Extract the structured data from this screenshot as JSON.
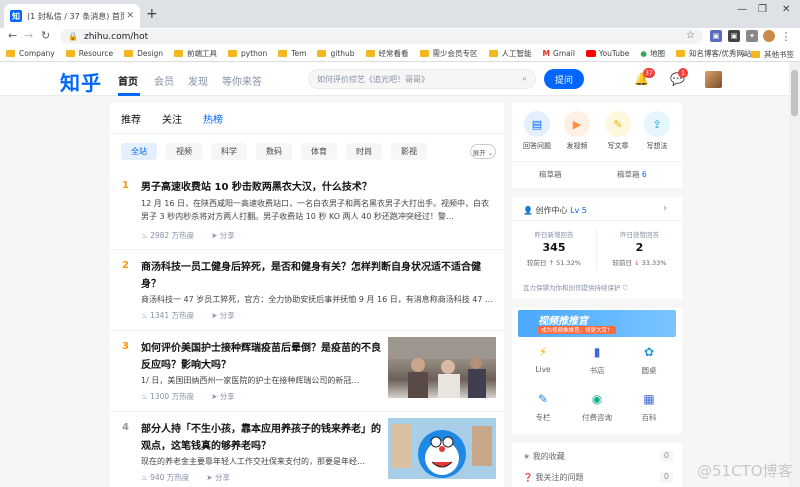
{
  "browser": {
    "tab_title": "(1 封私信 / 37 条消息) 首页 - 知",
    "tab_icon": "知",
    "url": "zhihu.com/hot",
    "bookmarks": [
      "Company",
      "Resource",
      "Design",
      "前端工具",
      "python",
      "Tem",
      "github",
      "经常看看",
      "需少会员专区",
      "人工智能",
      "Gmail",
      "YouTube",
      "地图",
      "知名博客/优秀网站"
    ],
    "bookmarks_right": "其他书签"
  },
  "header": {
    "logo": "知乎",
    "nav": [
      "首页",
      "会员",
      "发现",
      "等你来答"
    ],
    "search_placeholder": "如何评价综艺《追光吧！哥哥》",
    "ask_button": "提问",
    "notification_count": "37",
    "message_count": "1"
  },
  "feed": {
    "tabs": [
      "推荐",
      "关注",
      "热榜"
    ],
    "chips": [
      "全站",
      "视频",
      "科学",
      "数码",
      "体育",
      "时尚",
      "影视"
    ],
    "expand": "展开 ⌄",
    "items": [
      {
        "rank": "1",
        "title": "男子高速收费站 10 秒击败两黑衣大汉，什么技术？",
        "excerpt": "12 月 16 日，在陕西咸阳一高速收费站口，一名白衣男子和两名黑衣男子大打出手。视频中，白衣男子 3 秒内秒杀将对方两人打翻。男子收费站 10 秒 KO 两人 40 秒还跑冲突经过！警…",
        "heat": "2982 万热度",
        "share": "分享",
        "rank_color": "#ff9607"
      },
      {
        "rank": "2",
        "title": "商汤科技一员工健身后猝死，是否和健身有关？怎样判断自身状况适不适合健身？",
        "excerpt": "商汤科技一 47 岁员工猝死，官方：全力协助安抚后事并抚恤 9 月 16 日，有消息称商汤科技 47 …",
        "heat": "1341 万热度",
        "share": "分享",
        "rank_color": "#ff9607"
      },
      {
        "rank": "3",
        "title": "如何评价美国护士接种辉瑞疫苗后晕倒？是疫苗的不良反应吗？影响大吗？",
        "excerpt": "1/ 日，美国田纳西州一家医院的护士在接种辉瑞公司的新冠…",
        "heat": "1300 万热度",
        "share": "分享",
        "rank_color": "#ff9607"
      },
      {
        "rank": "4",
        "title": "部分人持「不生小孩，靠本应用养孩子的钱来养老」的观点，这笔钱真的够养老吗？",
        "excerpt": "现在的养老金主要靠年轻人工作交社保来支付的，那要是年经…",
        "heat": "940 万热度",
        "share": "分享",
        "rank_color": "#999999"
      }
    ]
  },
  "sidebar": {
    "creation_icons": [
      "回答问题",
      "发视频",
      "写文章",
      "写想法"
    ],
    "drafts_label": "稿草箱",
    "drafts_short": "稿草箱",
    "draft_count": "6",
    "creator_center": "创作中心",
    "creator_level": "Lv 5",
    "stat1_label": "昨日新增回答",
    "stat1_value": "345",
    "stat1_prefix": "较前日",
    "stat1_change": "51.32%",
    "stat2_label": "昨日获赞回答",
    "stat2_value": "2",
    "stat2_prefix": "较前日",
    "stat2_change": "33.33%",
    "creator_tip": "瓦力保镖为你和创作提供持续保护",
    "banner_title": "视频推推官",
    "banner_sub": "成为视频推推官，领更大赏！",
    "grid": [
      "Live",
      "书店",
      "圆桌",
      "专栏",
      "付费咨询",
      "百科"
    ],
    "links": [
      "我的收藏",
      "我关注的问题"
    ],
    "link_counts": [
      "0",
      "0"
    ]
  },
  "watermark": "@51CTO博客",
  "colors": {
    "brand": "#0066ff",
    "rank_hot": "#ff9607",
    "up": "#1aad19",
    "down": "#f1403c"
  }
}
